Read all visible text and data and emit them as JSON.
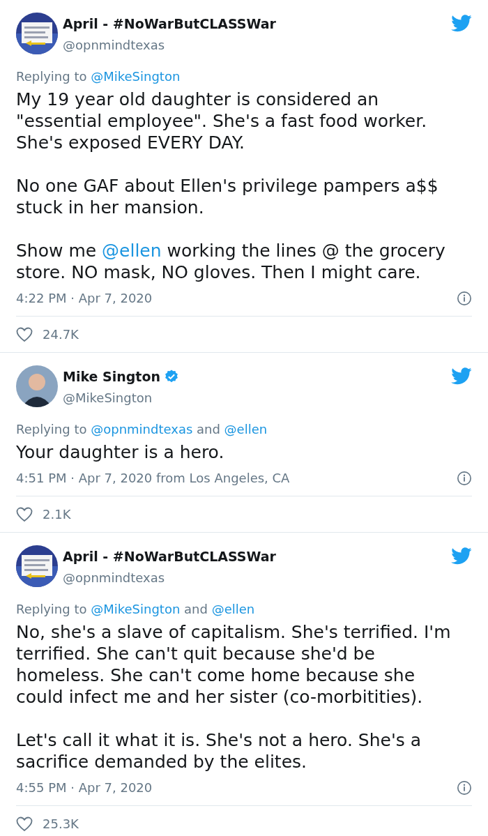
{
  "tweets": [
    {
      "avatar": {
        "kind": "picture"
      },
      "name": "April - #NoWarButCLASSWar",
      "verified": false,
      "handle": "@opnmindtexas",
      "replying": [
        {
          "kind": "text",
          "text": "Replying to "
        },
        {
          "kind": "mention",
          "text": "@MikeSington"
        }
      ],
      "paragraphs": [
        [
          {
            "kind": "text",
            "text": "My 19 year old daughter is considered an \"essential employee\". She's a fast food worker. She's exposed EVERY DAY."
          }
        ],
        [
          {
            "kind": "text",
            "text": "No one GAF about Ellen's privilege pampers a$$ stuck in her mansion."
          }
        ],
        [
          {
            "kind": "text",
            "text": "Show me "
          },
          {
            "kind": "mention",
            "text": "@ellen"
          },
          {
            "kind": "text",
            "text": " working the lines @ the grocery store. NO mask, NO gloves. Then I might care."
          }
        ]
      ],
      "time": "4:22 PM · Apr 7, 2020",
      "likes": "24.7K"
    },
    {
      "avatar": {
        "kind": "person"
      },
      "name": "Mike Sington",
      "verified": true,
      "handle": "@MikeSington",
      "replying": [
        {
          "kind": "text",
          "text": "Replying to "
        },
        {
          "kind": "mention",
          "text": "@opnmindtexas"
        },
        {
          "kind": "text",
          "text": " and "
        },
        {
          "kind": "mention",
          "text": "@ellen"
        }
      ],
      "paragraphs": [
        [
          {
            "kind": "text",
            "text": "Your daughter is a hero."
          }
        ]
      ],
      "time": "4:51 PM · Apr 7, 2020 from Los Angeles, CA",
      "likes": "2.1K"
    },
    {
      "avatar": {
        "kind": "picture"
      },
      "name": "April - #NoWarButCLASSWar",
      "verified": false,
      "handle": "@opnmindtexas",
      "replying": [
        {
          "kind": "text",
          "text": "Replying to "
        },
        {
          "kind": "mention",
          "text": "@MikeSington"
        },
        {
          "kind": "text",
          "text": " and "
        },
        {
          "kind": "mention",
          "text": "@ellen"
        }
      ],
      "paragraphs": [
        [
          {
            "kind": "text",
            "text": "No, she's a slave of capitalism. She's terrified. I'm terrified. She can't quit because she'd be homeless. She can't come home because she could infect me and her sister (co-morbitities)."
          }
        ],
        [
          {
            "kind": "text",
            "text": "Let's call it what it is. She's not a hero. She's a sacrifice demanded by the elites."
          }
        ]
      ],
      "time": "4:55 PM · Apr 7, 2020",
      "likes": "25.3K"
    }
  ]
}
